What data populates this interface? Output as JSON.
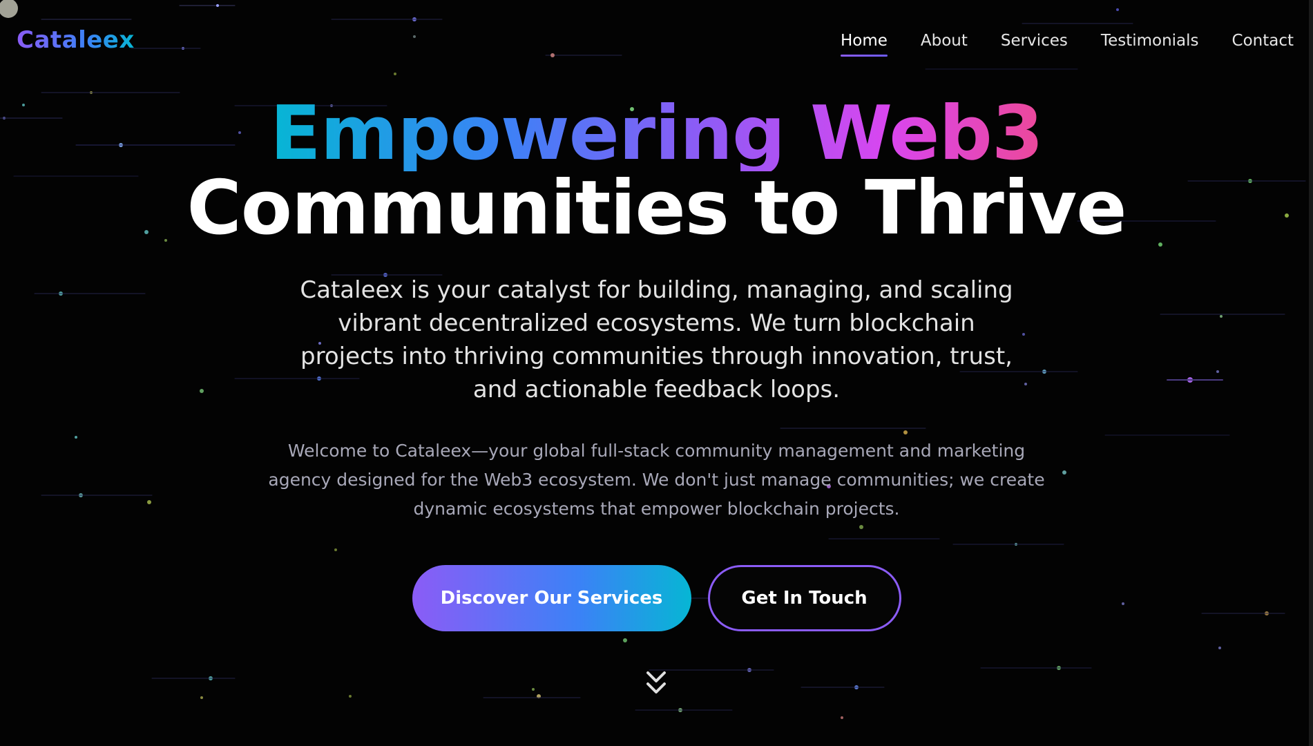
{
  "header": {
    "logo": "Cataleex",
    "nav": [
      {
        "label": "Home",
        "active": true
      },
      {
        "label": "About",
        "active": false
      },
      {
        "label": "Services",
        "active": false
      },
      {
        "label": "Testimonials",
        "active": false
      },
      {
        "label": "Contact",
        "active": false
      }
    ]
  },
  "hero": {
    "headline_gradient": "Empowering Web3",
    "headline_white": "Communities to Thrive",
    "lead": "Cataleex is your catalyst for building, managing, and scaling vibrant decentralized ecosystems. We turn blockchain projects into thriving communities through innovation, trust, and actionable feedback loops.",
    "sub": "Welcome to Cataleex—your global full-stack community management and marketing agency designed for the Web3 ecosystem. We don't just manage communities; we create dynamic ecosystems that empower blockchain projects.",
    "primary_cta": "Discover Our Services",
    "secondary_cta": "Get In Touch"
  },
  "icons": {
    "scroll": "chevrons-down-icon"
  },
  "colors": {
    "background": "#030303",
    "accent_purple": "#8b5cf6",
    "accent_blue": "#3b82f6",
    "accent_cyan": "#06b6d4",
    "accent_pink": "#ec4899"
  }
}
